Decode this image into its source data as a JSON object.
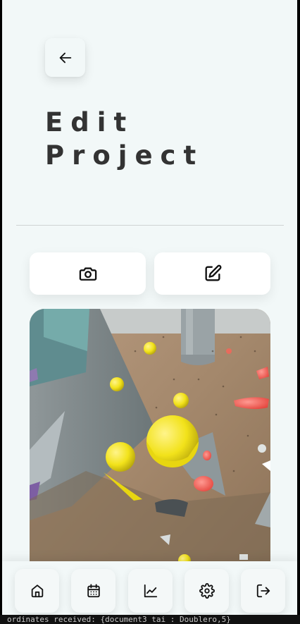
{
  "header": {
    "back_icon": "arrow-left-icon",
    "title_line1": "Edit",
    "title_line2": "Project"
  },
  "actions": {
    "camera_icon": "camera-icon",
    "edit_icon": "edit-icon"
  },
  "photo": {
    "subject": "climbing wall with holds"
  },
  "nav": {
    "items": [
      {
        "icon": "home-icon"
      },
      {
        "icon": "calendar-icon"
      },
      {
        "icon": "chart-line-icon"
      },
      {
        "icon": "gear-icon"
      },
      {
        "icon": "logout-icon"
      }
    ]
  },
  "console": {
    "text": "ordinates received: {document3 tai : Doublero,5}"
  },
  "colors": {
    "background": "#f2f8f8",
    "title": "#333333",
    "hold_yellow": "#f2e21a",
    "hold_red": "#f45a52"
  }
}
